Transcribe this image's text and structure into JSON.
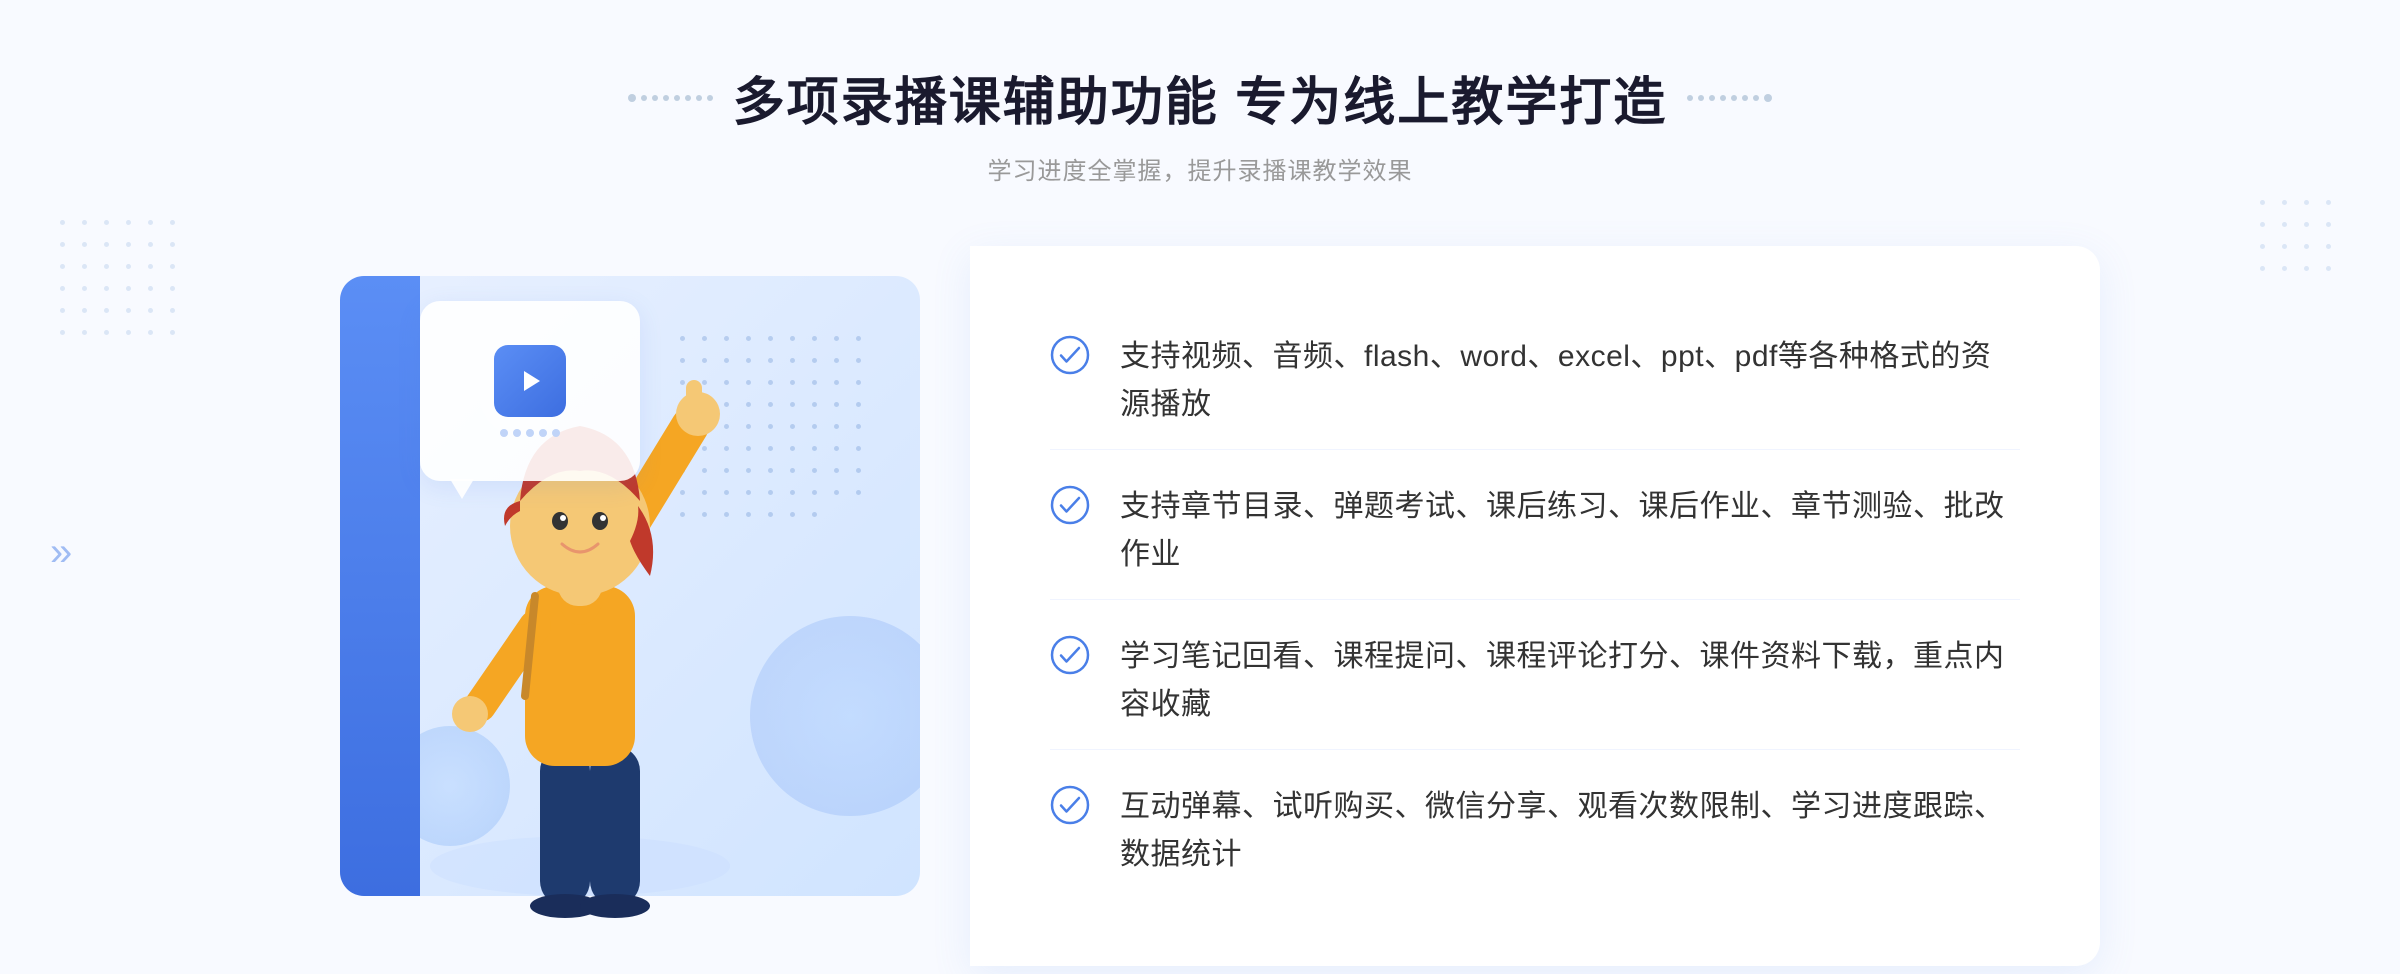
{
  "header": {
    "title": "多项录播课辅助功能 专为线上教学打造",
    "subtitle": "学习进度全掌握，提升录播课教学效果",
    "title_left_decoration": "decoration",
    "title_right_decoration": "decoration"
  },
  "features": [
    {
      "id": 1,
      "text": "支持视频、音频、flash、word、excel、ppt、pdf等各种格式的资源播放"
    },
    {
      "id": 2,
      "text": "支持章节目录、弹题考试、课后练习、课后作业、章节测验、批改作业"
    },
    {
      "id": 3,
      "text": "学习笔记回看、课程提问、课程评论打分、课件资料下载，重点内容收藏"
    },
    {
      "id": 4,
      "text": "互动弹幕、试听购买、微信分享、观看次数限制、学习进度跟踪、数据统计"
    }
  ],
  "colors": {
    "primary_blue": "#4a7fe8",
    "light_blue": "#e8f0ff",
    "text_dark": "#1a1a2e",
    "text_gray": "#999999",
    "text_body": "#333333"
  },
  "icons": {
    "check": "check-circle-icon",
    "play": "play-icon",
    "arrow_left": "arrow-left-icon",
    "double_arrow": "double-arrow-icon"
  }
}
